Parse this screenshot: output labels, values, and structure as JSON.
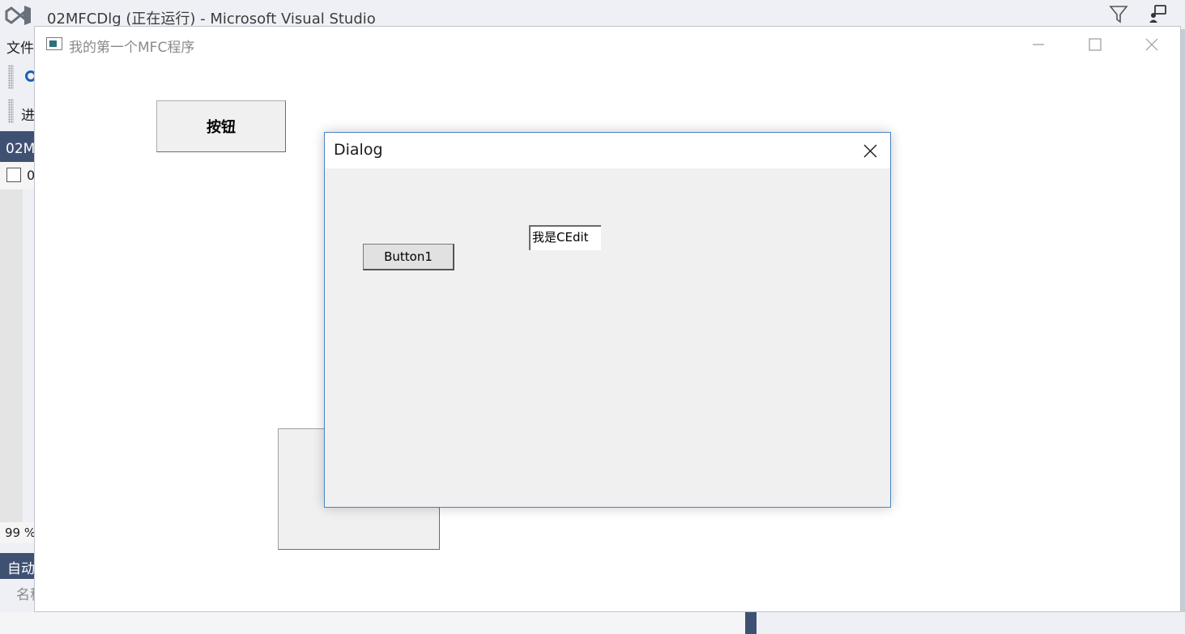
{
  "vs": {
    "window_title": "02MFCDlg (正在运行) - Microsoft Visual Studio",
    "menu_file": "文件",
    "process_label": "进",
    "doc_tab": "02M",
    "file_label": "0",
    "zoom": "99 %",
    "auto_panel": "自动",
    "name_column": "名称"
  },
  "mfc_window": {
    "title": "我的第一个MFC程序",
    "button_label": "按钮"
  },
  "dialog": {
    "title": "Dialog",
    "button1_label": "Button1",
    "edit_value": "我是CEdit"
  }
}
